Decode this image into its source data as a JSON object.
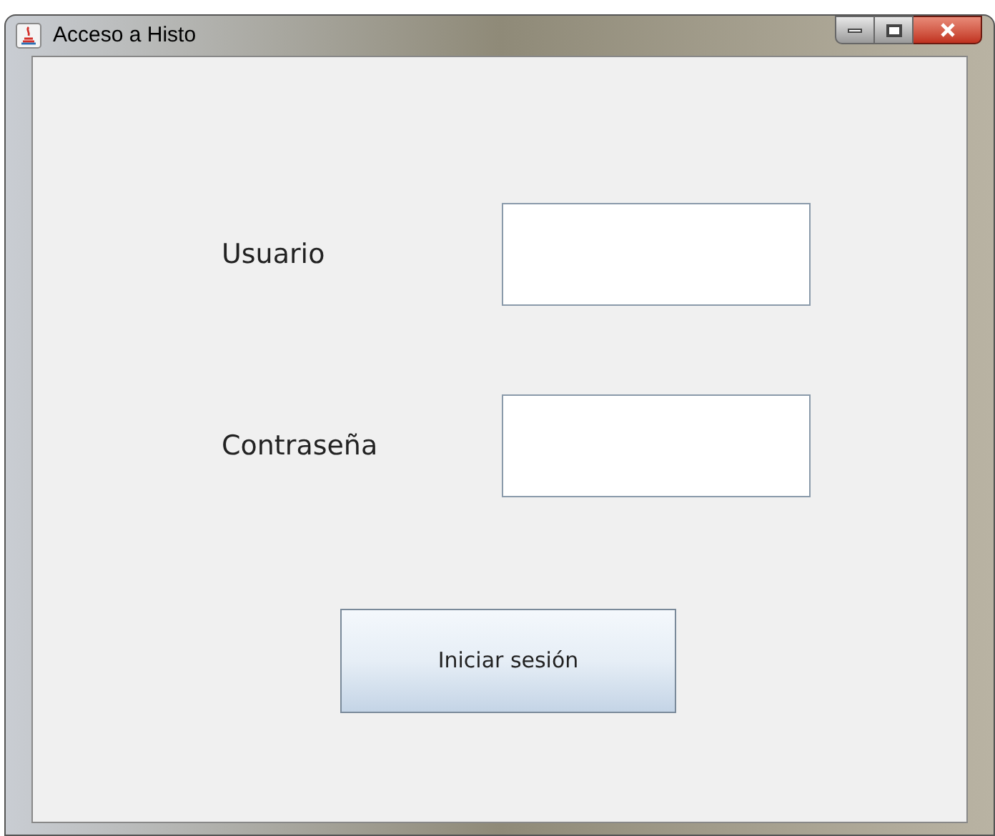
{
  "window": {
    "title": "Acceso a Histo"
  },
  "fields": [
    {
      "label": "Usuario"
    },
    {
      "label": "Contraseña"
    }
  ],
  "button": {
    "label": "Iniciar sesión"
  }
}
